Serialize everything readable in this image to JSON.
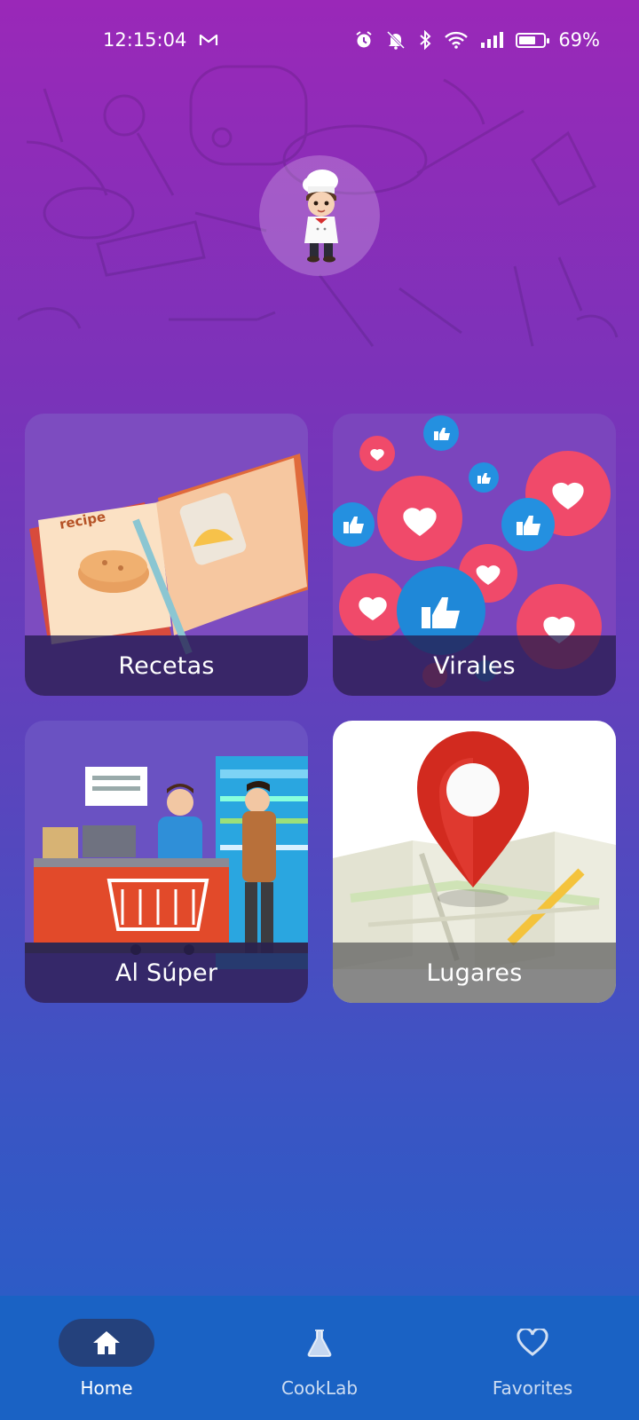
{
  "status_bar": {
    "time": "12:15:04",
    "battery_text": "69%",
    "battery_level": 0.69,
    "icons": [
      "gmail-icon",
      "alarm-icon",
      "mute-icon",
      "bluetooth-icon",
      "wifi-icon",
      "signal-icon",
      "battery-icon"
    ]
  },
  "header": {
    "avatar_icon": "chef-avatar-icon",
    "background_pattern": "kitchen-utensils-pattern"
  },
  "cards": [
    {
      "label": "Recetas",
      "icon": "recipe-book-illustration"
    },
    {
      "label": "Virales",
      "icon": "likes-hearts-illustration"
    },
    {
      "label": "Al Súper",
      "icon": "supermarket-checkout-illustration"
    },
    {
      "label": "Lugares",
      "icon": "map-pin-illustration"
    }
  ],
  "bottom_nav": {
    "items": [
      {
        "label": "Home",
        "icon": "home-icon",
        "active": true
      },
      {
        "label": "CookLab",
        "icon": "flask-icon",
        "active": false
      },
      {
        "label": "Favorites",
        "icon": "heart-icon",
        "active": false
      }
    ]
  },
  "colors": {
    "gradient_top": "#9a28b8",
    "gradient_bottom": "#2460c8",
    "nav_background": "#1a62c4",
    "card_label_overlay": "#261c50"
  }
}
